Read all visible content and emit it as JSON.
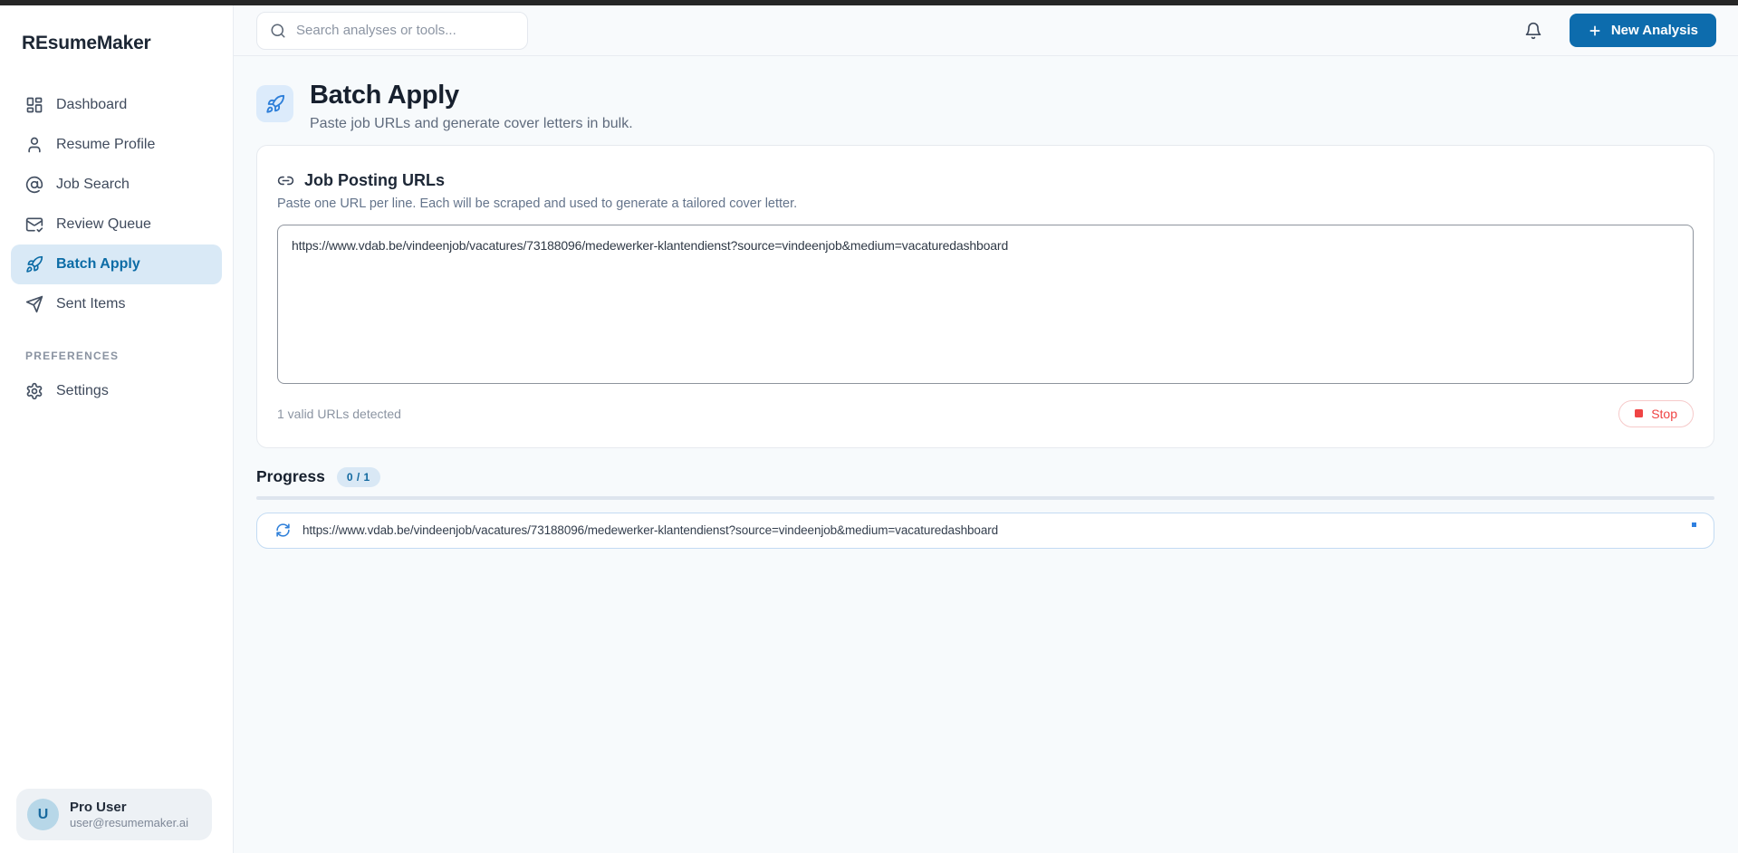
{
  "app": {
    "name": "REsumeMaker"
  },
  "topbar": {
    "search_placeholder": "Search analyses or tools...",
    "new_analysis_label": "New Analysis"
  },
  "sidebar": {
    "items": [
      {
        "label": "Dashboard",
        "icon": "dashboard-grid-icon",
        "active": false
      },
      {
        "label": "Resume Profile",
        "icon": "person-icon",
        "active": false
      },
      {
        "label": "Job Search",
        "icon": "at-sign-icon",
        "active": false
      },
      {
        "label": "Review Queue",
        "icon": "mail-check-icon",
        "active": false
      },
      {
        "label": "Batch Apply",
        "icon": "rocket-icon",
        "active": true
      },
      {
        "label": "Sent Items",
        "icon": "send-icon",
        "active": false
      }
    ],
    "preferences_header": "PREFERENCES",
    "preferences_items": [
      {
        "label": "Settings",
        "icon": "gear-icon"
      }
    ],
    "user": {
      "initial": "U",
      "name": "Pro User",
      "email": "user@resumemaker.ai"
    }
  },
  "page": {
    "title": "Batch Apply",
    "subtitle": "Paste job URLs and generate cover letters in bulk."
  },
  "url_card": {
    "title": "Job Posting URLs",
    "subtitle": "Paste one URL per line. Each will be scraped and used to generate a tailored cover letter.",
    "textarea_value": "https://www.vdab.be/vindeenjob/vacatures/73188096/medewerker-klantendienst?source=vindeenjob&medium=vacaturedashboard",
    "valid_count_text": "1 valid URLs detected",
    "stop_label": "Stop"
  },
  "progress": {
    "title": "Progress",
    "badge": "0 / 1",
    "percent_complete": 0,
    "items": [
      {
        "url": "https://www.vdab.be/vindeenjob/vacatures/73188096/medewerker-klantendienst?source=vindeenjob&medium=vacaturedashboard",
        "status": "loading"
      }
    ]
  },
  "colors": {
    "accent_blue": "#0d6cad",
    "icon_blue": "#2e7fd9",
    "active_item_bg": "#d9e9f6",
    "danger_red": "#ef4444",
    "badge_bg": "#d9e8f5",
    "top_strip": "#262626",
    "main_bg": "#f7fafc"
  }
}
